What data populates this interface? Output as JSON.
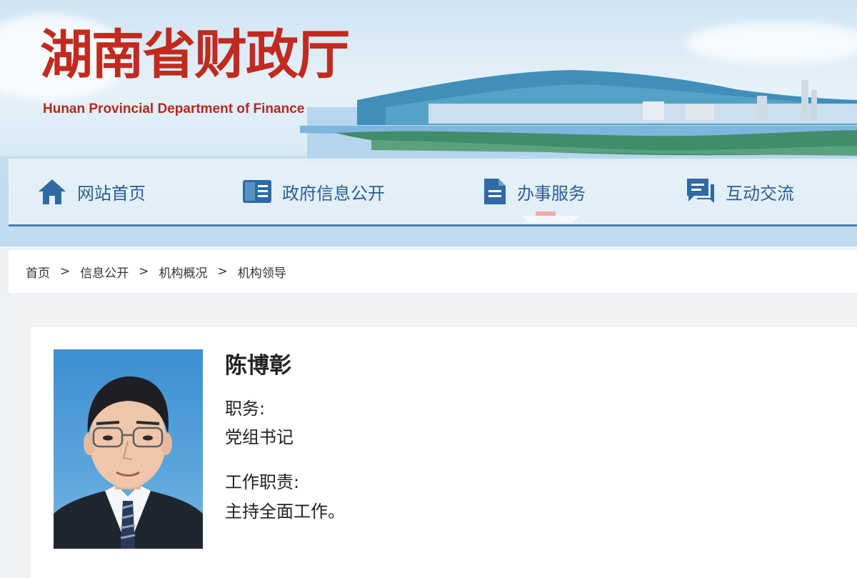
{
  "header": {
    "title_cn": "湖南省财政厅",
    "title_en": "Hunan Provincial Department of Finance"
  },
  "nav": {
    "items": [
      {
        "label": "网站首页",
        "icon": "home-icon"
      },
      {
        "label": "政府信息公开",
        "icon": "document-list-icon"
      },
      {
        "label": "办事服务",
        "icon": "file-icon"
      },
      {
        "label": "互动交流",
        "icon": "chat-icon"
      }
    ]
  },
  "breadcrumb": {
    "items": [
      "首页",
      "信息公开",
      "机构概况",
      "机构领导"
    ],
    "separator": ">"
  },
  "profile": {
    "name": "陈博彰",
    "position_label": "职务:",
    "position_value": "党组书记",
    "duty_label": "工作职责:",
    "duty_value": "主持全面工作。"
  },
  "colors": {
    "title_red": "#c22a1f",
    "nav_blue": "#2a5f93",
    "nav_border": "#4a7fae"
  }
}
